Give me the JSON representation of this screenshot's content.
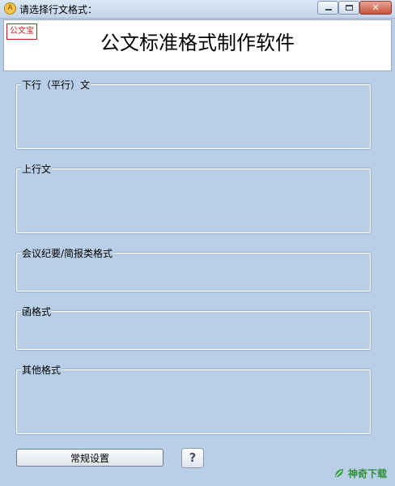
{
  "window": {
    "title": "请选择行文格式：",
    "app_icon_glyph": "A",
    "icons": {
      "app": "app-icon",
      "minimize": "minimize-icon",
      "maximize": "maximize-icon",
      "close": "close-icon"
    },
    "close_glyph": "✕"
  },
  "header": {
    "title": "公文标准格式制作软件",
    "seal_text": "公文宝"
  },
  "groups": [
    {
      "label": "下行（平行）文"
    },
    {
      "label": "上行文"
    },
    {
      "label": "会议纪要/简报类格式"
    },
    {
      "label": "函格式"
    },
    {
      "label": "其他格式"
    }
  ],
  "footer": {
    "settings_label": "常规设置",
    "help_label": "?"
  },
  "watermark": {
    "text": "神奇下载",
    "icon": "leaf-icon"
  },
  "colors": {
    "background": "#b9cfe8",
    "title_bar": "#c3d5ea",
    "close_button": "#c6533c",
    "seal": "#c42020",
    "watermark": "#2f8f3b"
  }
}
